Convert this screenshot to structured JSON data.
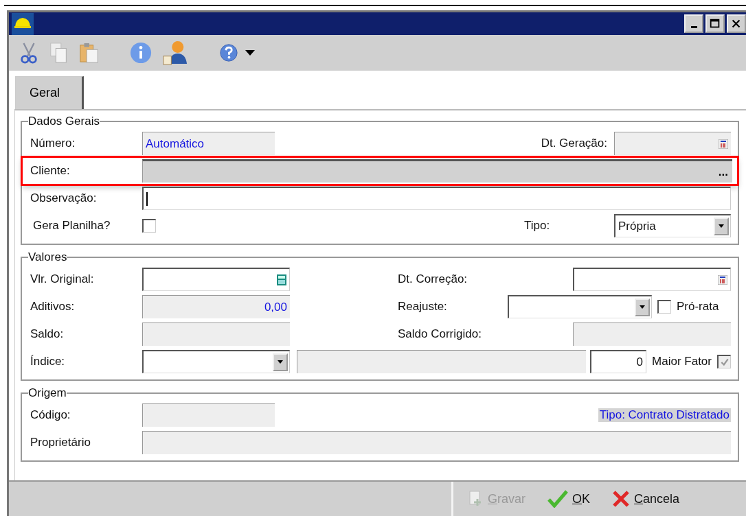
{
  "tabs": [
    {
      "label": "Geral",
      "selected": true
    }
  ],
  "dados_gerais": {
    "title": "Dados Gerais",
    "numero": {
      "label": "Número:",
      "value": "Automático",
      "disabled": true
    },
    "dt_geracao": {
      "label": "Dt. Geração:",
      "disabled": true
    },
    "cliente": {
      "label": "Cliente:",
      "button": "...",
      "disabled": true,
      "highlighted": true
    },
    "observacao": {
      "label": "Observação:",
      "disabled": false
    },
    "gera_planilha": {
      "label": "Gera Planilha?",
      "checked": false
    },
    "tipo": {
      "label": "Tipo:",
      "value": "Própria"
    }
  },
  "valores": {
    "title": "Valores",
    "vlr_original": {
      "label": "Vlr. Original:",
      "disabled": false
    },
    "dt_correcao": {
      "label": "Dt. Correção:",
      "disabled": false
    },
    "aditivos": {
      "label": "Aditivos:",
      "value": "0,00",
      "disabled": true
    },
    "reajuste": {
      "label": "Reajuste:"
    },
    "pro_rata": {
      "label": "Pró-rata",
      "checked": false
    },
    "saldo": {
      "label": "Saldo:",
      "disabled": true
    },
    "saldo_corrigido": {
      "label": "Saldo Corrigido:",
      "disabled": true
    },
    "indice": {
      "label": "Índice:",
      "description_disabled": true
    },
    "fator": {
      "value": "0"
    },
    "maior_fator": {
      "label": "Maior Fator",
      "checked": true,
      "disabled": true
    }
  },
  "origem": {
    "title": "Origem",
    "codigo": {
      "label": "Código:",
      "disabled": true
    },
    "tipo_note": "Tipo: Contrato Distratado",
    "proprietario": {
      "label": "Proprietário",
      "disabled": true
    }
  },
  "buttons": [
    {
      "label": "Gravar",
      "kind": "save",
      "disabled": true
    },
    {
      "label": "OK",
      "kind": "ok",
      "disabled": false
    },
    {
      "label": "Cancela",
      "kind": "cancel",
      "disabled": false
    }
  ]
}
